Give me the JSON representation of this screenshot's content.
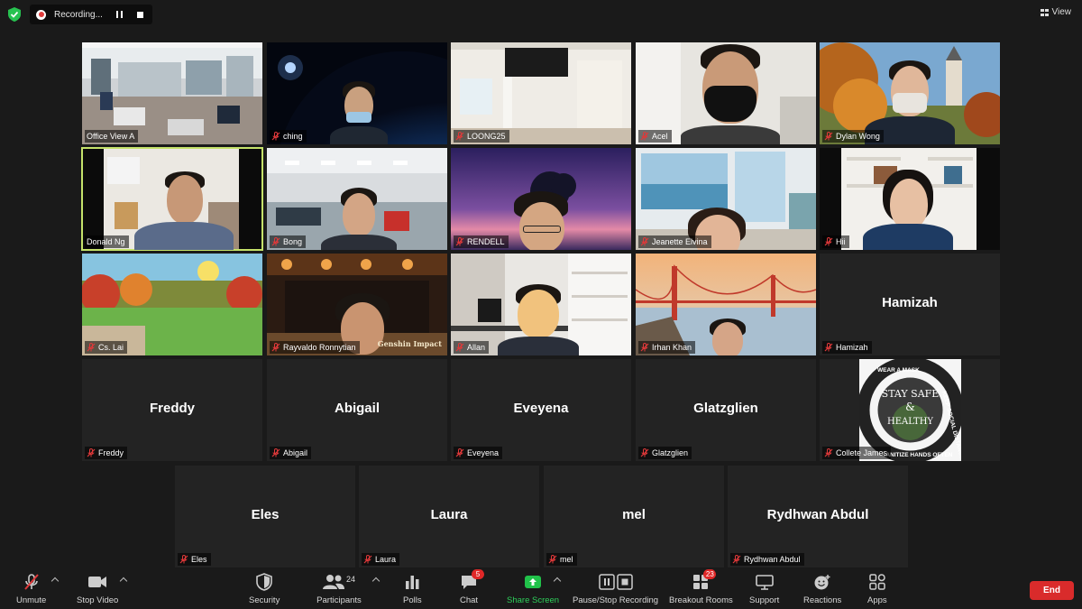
{
  "recording": {
    "label": "Recording..."
  },
  "view": {
    "label": "View"
  },
  "tiles": [
    {
      "name": "Office View A",
      "muted": false,
      "speaking": false,
      "video": true
    },
    {
      "name": "ching",
      "muted": true,
      "speaking": false,
      "video": true
    },
    {
      "name": "LOONG25",
      "muted": true,
      "speaking": false,
      "video": true
    },
    {
      "name": "Acel",
      "muted": true,
      "speaking": false,
      "video": true
    },
    {
      "name": "Dylan Wong",
      "muted": true,
      "speaking": false,
      "video": true
    },
    {
      "name": "Donald Ng",
      "muted": false,
      "speaking": true,
      "video": true
    },
    {
      "name": "Bong",
      "muted": true,
      "speaking": false,
      "video": true
    },
    {
      "name": "RENDELL",
      "muted": true,
      "speaking": false,
      "video": true
    },
    {
      "name": "Jeanette Elvina",
      "muted": true,
      "speaking": false,
      "video": true
    },
    {
      "name": "Hii",
      "muted": true,
      "speaking": false,
      "video": true
    },
    {
      "name": "Cs. Lai",
      "muted": true,
      "speaking": false,
      "video": true
    },
    {
      "name": "Rayvaldo Ronnytian",
      "muted": true,
      "speaking": false,
      "video": true
    },
    {
      "name": "Allan",
      "muted": true,
      "speaking": false,
      "video": true
    },
    {
      "name": "Irhan Khan",
      "muted": true,
      "speaking": false,
      "video": true
    },
    {
      "name": "Hamizah",
      "display": "Hamizah",
      "muted": true,
      "speaking": false,
      "video": false
    },
    {
      "name": "Freddy",
      "display": "Freddy",
      "muted": true,
      "speaking": false,
      "video": false
    },
    {
      "name": "Abigail",
      "display": "Abigail",
      "muted": true,
      "speaking": false,
      "video": false
    },
    {
      "name": "Eveyena",
      "display": "Eveyena",
      "muted": true,
      "speaking": false,
      "video": false
    },
    {
      "name": "Glatzglien",
      "display": "Glatzglien",
      "muted": true,
      "speaking": false,
      "video": false
    },
    {
      "name": "Collete James",
      "muted": true,
      "speaking": false,
      "video": false,
      "avatar_text": [
        "WEAR A MASK",
        "KEEP SOCIAL DISTANCE",
        "SANITIZE HANDS OFTEN",
        "STAY SAFE",
        "&",
        "HEALTHY"
      ]
    },
    {
      "name": "Eles",
      "display": "Eles",
      "muted": true,
      "speaking": false,
      "video": false
    },
    {
      "name": "Laura",
      "display": "Laura",
      "muted": true,
      "speaking": false,
      "video": false
    },
    {
      "name": "mel",
      "display": "mel",
      "muted": true,
      "speaking": false,
      "video": false
    },
    {
      "name": "Rydhwan Abdul",
      "display": "Rydhwan Abdul",
      "muted": true,
      "speaking": false,
      "video": false
    }
  ],
  "toolbar": {
    "unmute": "Unmute",
    "stop_video": "Stop Video",
    "security": "Security",
    "participants": "Participants",
    "participants_count": "24",
    "polls": "Polls",
    "chat": "Chat",
    "chat_badge": "5",
    "share_screen": "Share Screen",
    "pause_stop_recording": "Pause/Stop Recording",
    "breakout_rooms": "Breakout Rooms",
    "breakout_badge": "23",
    "support": "Support",
    "reactions": "Reactions",
    "apps": "Apps",
    "end": "End"
  },
  "colors": {
    "speaking_border": "#c5e26a",
    "share_screen_green": "#21c24a",
    "end_red": "#d92b2b",
    "badge_red": "#e02828",
    "mute_red": "#e0393a"
  },
  "game_logo": "Genshin Impact"
}
